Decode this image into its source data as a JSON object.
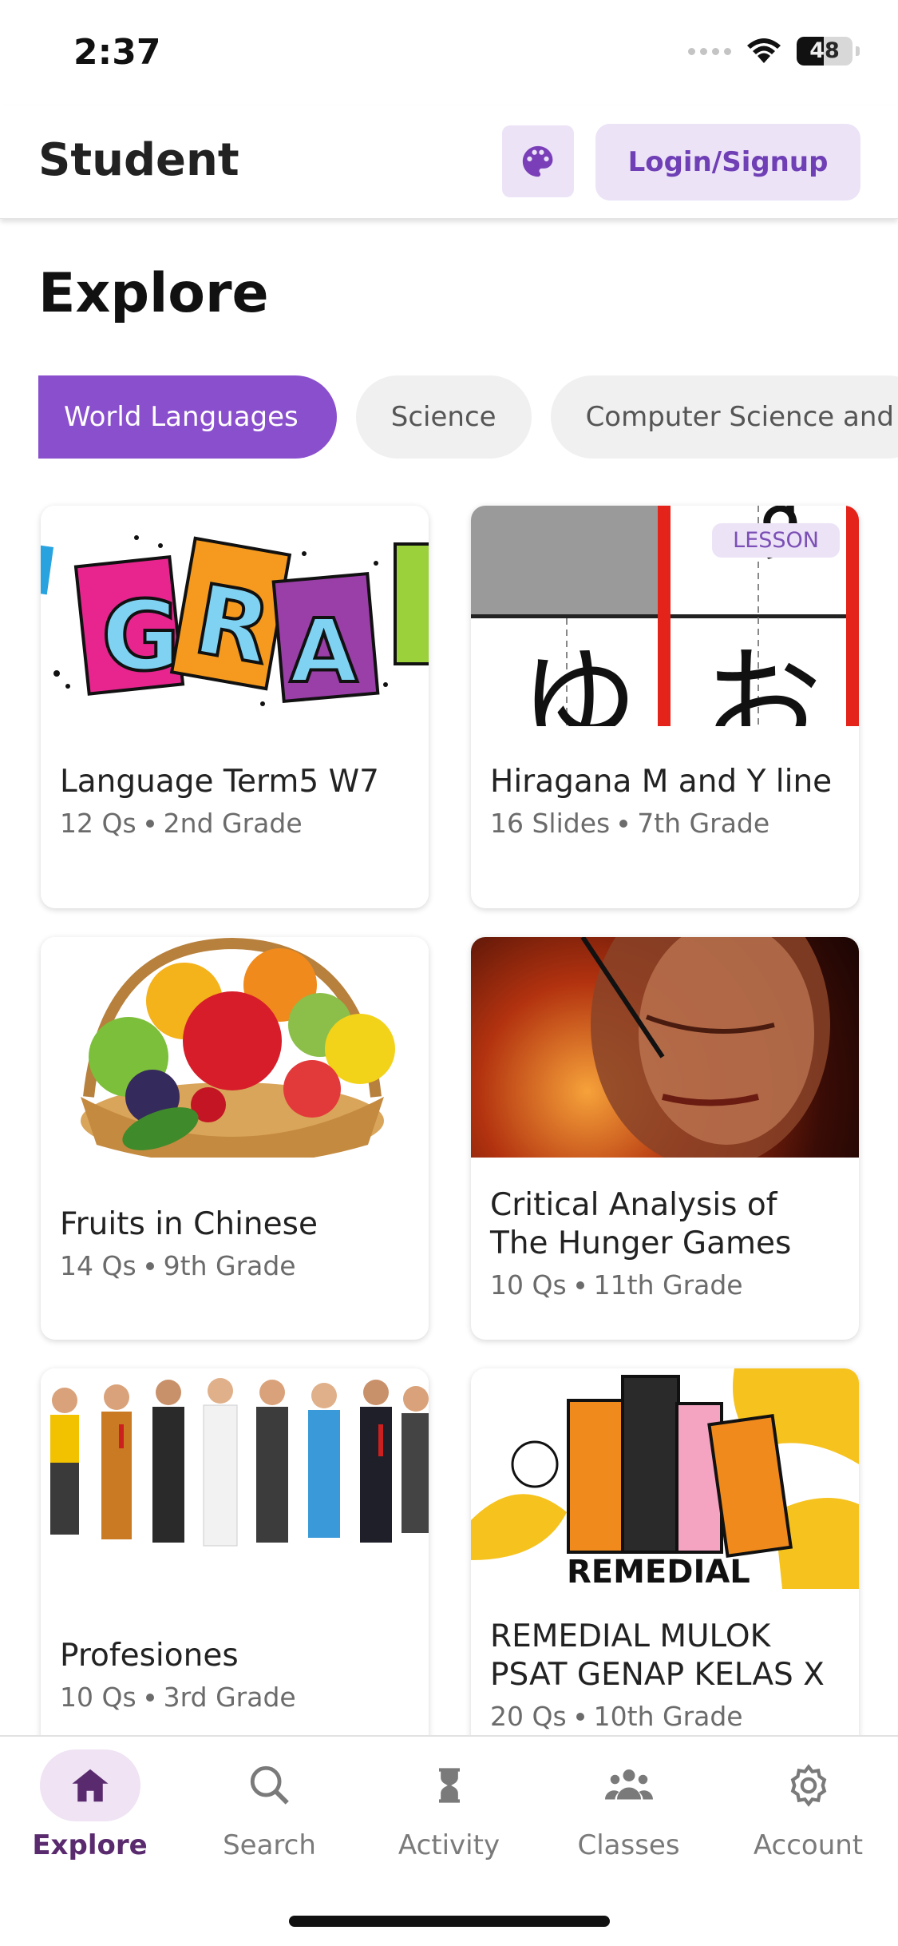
{
  "status_bar": {
    "time": "2:37",
    "battery": "48",
    "battery_level": 0.48
  },
  "header": {
    "title": "Student",
    "theme_icon": "palette-icon",
    "login_label": "Login/Signup"
  },
  "page": {
    "title": "Explore"
  },
  "chips": [
    {
      "label": "World Languages",
      "active": true
    },
    {
      "label": "Science",
      "active": false
    },
    {
      "label": "Computer Science and",
      "active": false
    }
  ],
  "cards": [
    {
      "title": "Language Term5 W7",
      "count": "12 Qs",
      "grade": "2nd Grade",
      "image": "gra-letters-image"
    },
    {
      "title": "Hiragana M and Y line",
      "count": "16 Slides",
      "grade": "7th Grade",
      "badge": "LESSON",
      "image": "hiragana-image"
    },
    {
      "title": "Fruits in Chinese",
      "count": "14 Qs",
      "grade": "9th Grade",
      "image": "fruit-basket-image"
    },
    {
      "title": "Critical Analysis of The Hunger Games",
      "count": "10 Qs",
      "grade": "11th Grade",
      "image": "hunger-games-image"
    },
    {
      "title": "Profesiones",
      "count": "10 Qs",
      "grade": "3rd Grade",
      "image": "professions-image"
    },
    {
      "title": "REMEDIAL MULOK PSAT GENAP KELAS X",
      "count": "20 Qs",
      "grade": "10th Grade",
      "image": "remedial-books-image",
      "image_text": "REMEDIAL"
    }
  ],
  "nav": [
    {
      "label": "Explore",
      "icon": "home-icon",
      "active": true
    },
    {
      "label": "Search",
      "icon": "search-icon",
      "active": false
    },
    {
      "label": "Activity",
      "icon": "hourglass-icon",
      "active": false
    },
    {
      "label": "Classes",
      "icon": "people-icon",
      "active": false
    },
    {
      "label": "Account",
      "icon": "gear-icon",
      "active": false
    }
  ],
  "colors": {
    "accent": "#8a4fcd",
    "accent_light": "#ece3f7",
    "nav_active": "#5a2a6e"
  }
}
